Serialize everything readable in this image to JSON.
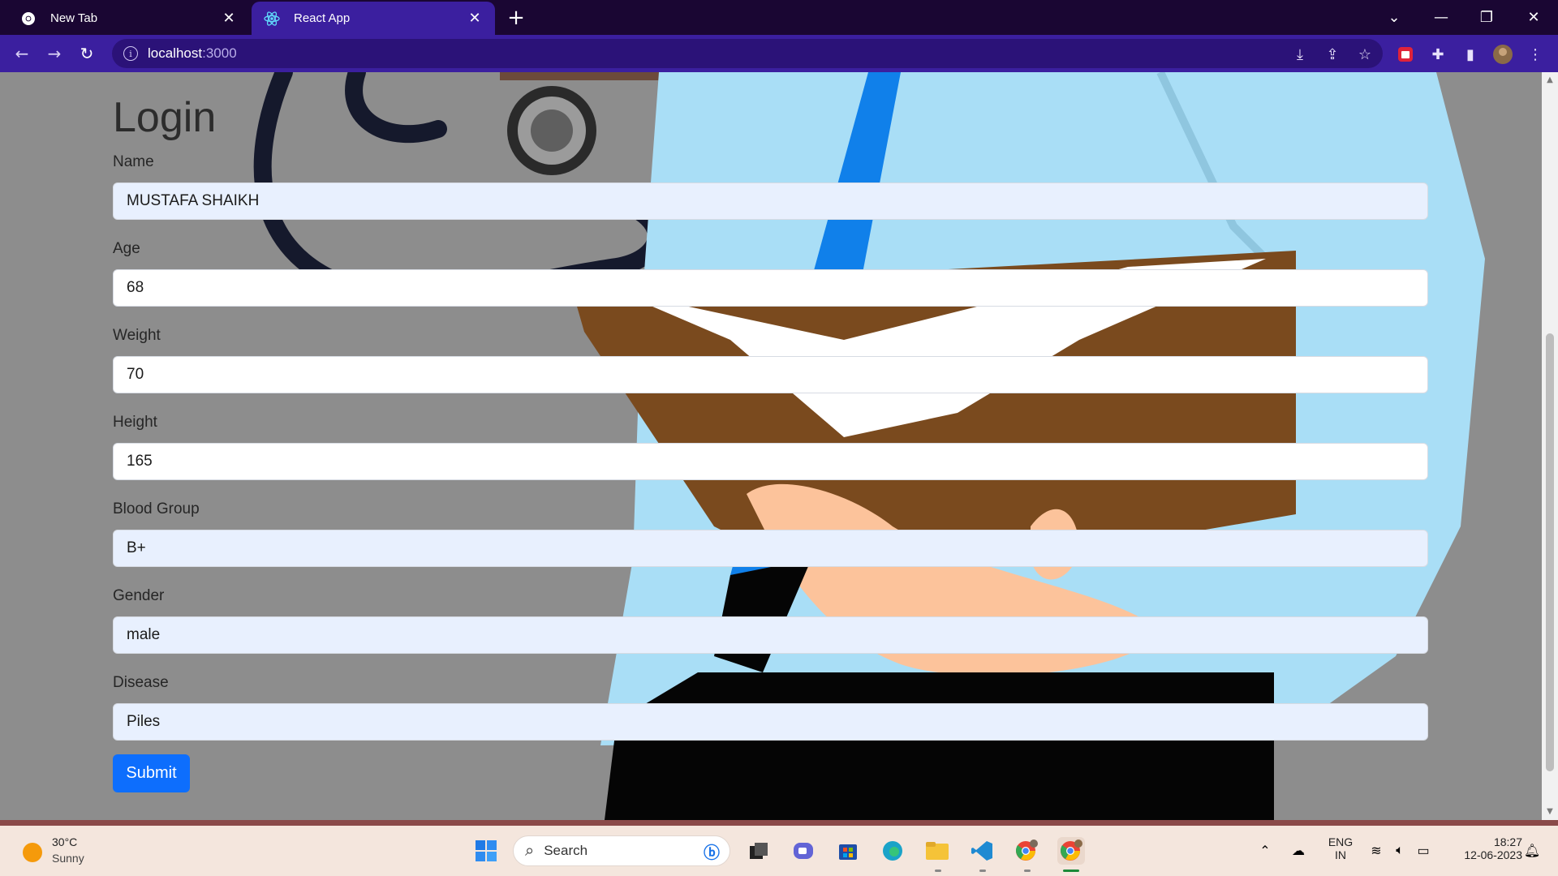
{
  "browser": {
    "tabs": [
      {
        "label": "New Tab",
        "active": false,
        "icon": "chrome-icon"
      },
      {
        "label": "React App",
        "active": true,
        "icon": "react-icon"
      }
    ],
    "address": {
      "host": "localhost",
      "port": ":3000"
    }
  },
  "page": {
    "title": "Login",
    "fields": [
      {
        "label": "Name",
        "value": "MUSTAFA SHAIKH"
      },
      {
        "label": "Age",
        "value": "68"
      },
      {
        "label": "Weight",
        "value": "70"
      },
      {
        "label": "Height",
        "value": "165"
      },
      {
        "label": "Blood Group",
        "value": "B+"
      },
      {
        "label": "Gender",
        "value": "male"
      },
      {
        "label": "Disease",
        "value": "Piles"
      }
    ],
    "submit_label": "Submit"
  },
  "taskbar": {
    "weather": {
      "temp": "30°C",
      "condition": "Sunny"
    },
    "search_placeholder": "Search",
    "language": {
      "line1": "ENG",
      "line2": "IN"
    },
    "clock": {
      "time": "18:27",
      "date": "12-06-2023"
    }
  },
  "colors": {
    "tab_bar": "#1a0633",
    "toolbar": "#3b1f9f",
    "submit": "#0d6efd",
    "page_background": "#8d8d8d"
  }
}
